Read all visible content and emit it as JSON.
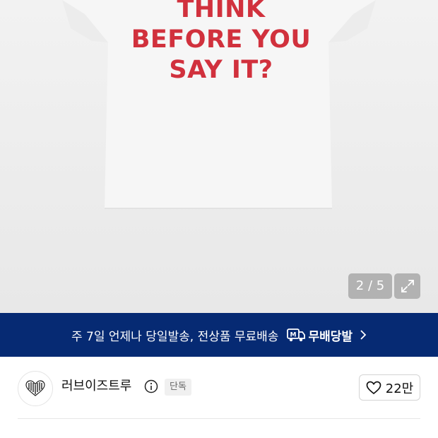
{
  "gallery": {
    "shirt_print_lines": [
      "THINK",
      "BEFORE YOU",
      "SAY IT?"
    ],
    "page_counter": "2 / 5",
    "print_color": "#d1313d",
    "expand_icon": "expand-arrows-icon"
  },
  "banner": {
    "text": "주 7일 언제나 당일발송, 전상품 무료배송",
    "badge_label": "무배당발",
    "badge_icon": "m-delivery-truck-icon",
    "background": "#062a73"
  },
  "shop": {
    "name": "러브이즈트루",
    "badge": "단독",
    "info_icon": "info-icon",
    "like_count": "22만",
    "like_icon": "heart-icon"
  }
}
